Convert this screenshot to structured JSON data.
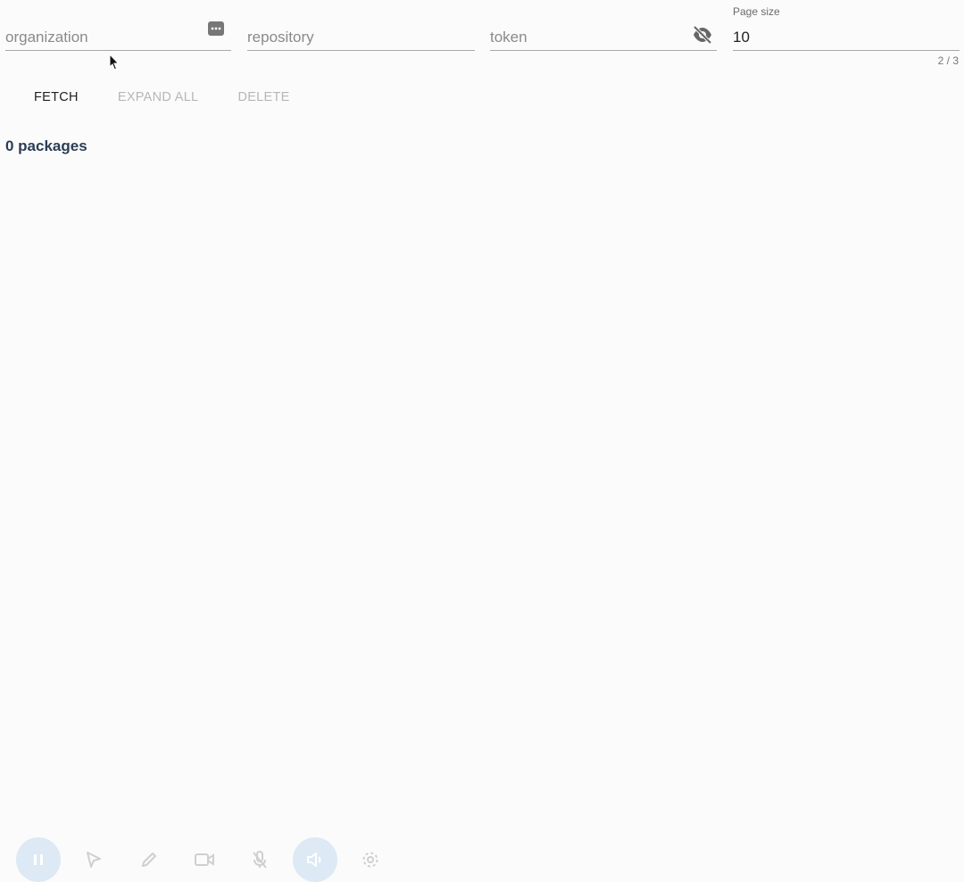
{
  "fields": {
    "organization": {
      "placeholder": "organization",
      "value": ""
    },
    "repository": {
      "placeholder": "repository",
      "value": ""
    },
    "token": {
      "placeholder": "token",
      "value": ""
    },
    "page_size": {
      "label": "Page size",
      "value": "10"
    }
  },
  "counter": "2 / 3",
  "actions": {
    "fetch": "FETCH",
    "expand_all": "EXPAND ALL",
    "delete": "DELETE"
  },
  "summary": {
    "packages": "0 packages"
  },
  "icons": {
    "organization_trailing": "more-horizontal-icon",
    "token_trailing": "eye-off-icon",
    "cursor": "mouse-pointer-icon",
    "recorder": [
      "pause-icon",
      "select-arrow-icon",
      "pencil-icon",
      "video-camera-icon",
      "mic-off-icon",
      "speaker-icon",
      "gear-icon"
    ]
  },
  "colors": {
    "accent_text": "#2c3e55",
    "disabled_text": "#b7b7b7",
    "recorder_bubble": "#dde9f4"
  }
}
